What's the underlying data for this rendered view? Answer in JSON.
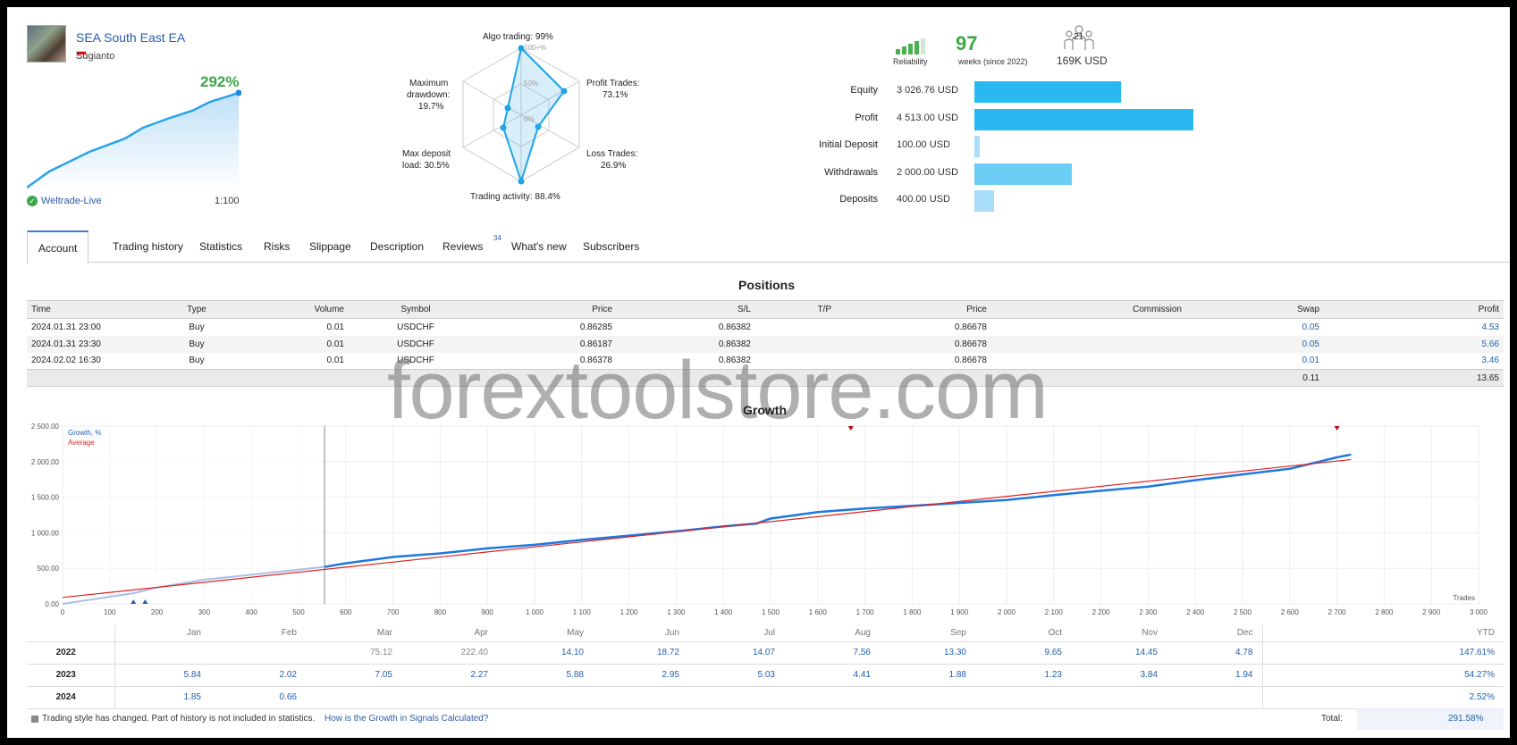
{
  "profile": {
    "name": "SEA South East EA",
    "author": "Sugianto",
    "growth": "292%",
    "broker": "Weltrade-Live",
    "leverage": "1:100"
  },
  "radar": {
    "algo": "Algo trading: 99%",
    "profit_trades": [
      "Profit Trades:",
      "73.1%"
    ],
    "loss_trades": [
      "Loss Trades:",
      "26.9%"
    ],
    "activity": "Trading activity: 88.4%",
    "deposit_load": [
      "Max deposit",
      "load: 30.5%"
    ],
    "drawdown": [
      "Maximum",
      "drawdown:",
      "19.7%"
    ],
    "ring_labels": [
      "100+%",
      "50%",
      "0%"
    ]
  },
  "stats": {
    "reliability_label": "Reliability",
    "weeks": "97",
    "weeks_label": "weeks (since 2022)",
    "subscribers": "21",
    "funds": "169K USD"
  },
  "balances": [
    {
      "label": "Equity",
      "value": "3 026.76 USD",
      "amount": 3026.76,
      "color": "#29b9f0"
    },
    {
      "label": "Profit",
      "value": "4 513.00 USD",
      "amount": 4513.0,
      "color": "#29b9f0"
    },
    {
      "label": "Initial Deposit",
      "value": "100.00 USD",
      "amount": 100.0,
      "color": "#a8def7"
    },
    {
      "label": "Withdrawals",
      "value": "2 000.00 USD",
      "amount": 2000.0,
      "color": "#6bcdf4"
    },
    {
      "label": "Deposits",
      "value": "400.00 USD",
      "amount": 400.0,
      "color": "#a8def7"
    }
  ],
  "tabs": [
    "Account",
    "Trading history",
    "Statistics",
    "Risks",
    "Slippage",
    "Description",
    "Reviews",
    "What's new",
    "Subscribers"
  ],
  "reviews_count": "34",
  "positions": {
    "title": "Positions",
    "headers": [
      "Time",
      "Type",
      "Volume",
      "Symbol",
      "Price",
      "S/L",
      "T/P",
      "Price",
      "Commission",
      "Swap",
      "Profit"
    ],
    "rows": [
      [
        "2024.01.31 23:00",
        "Buy",
        "0.01",
        "USDCHF",
        "0.86285",
        "0.86382",
        "",
        "0.86678",
        "",
        "0.05",
        "4.53"
      ],
      [
        "2024.01.31 23:30",
        "Buy",
        "0.01",
        "USDCHF",
        "0.86187",
        "0.86382",
        "",
        "0.86678",
        "",
        "0.05",
        "5.66"
      ],
      [
        "2024.02.02 16:30",
        "Buy",
        "0.01",
        "USDCHF",
        "0.86378",
        "0.86382",
        "",
        "0.86678",
        "",
        "0.01",
        "3.46"
      ]
    ],
    "total_swap": "0.11",
    "total_profit": "13.65"
  },
  "watermark": "forextoolstore.com",
  "growth_chart": {
    "title": "Growth",
    "legend_growth": "Growth, %",
    "legend_average": "Average",
    "x_label": "Trades",
    "y_ticks": [
      "0.00",
      "500.00",
      "1 000.00",
      "1 500.00",
      "2 000.00",
      "2 500.00"
    ],
    "x_ticks": [
      "0",
      "100",
      "200",
      "300",
      "400",
      "500",
      "600",
      "700",
      "800",
      "900",
      "1 000",
      "1 100",
      "1 200",
      "1 300",
      "1 400",
      "1 500",
      "1 600",
      "1 700",
      "1 800",
      "1 900",
      "2 000",
      "2 100",
      "2 200",
      "2 300",
      "2 400",
      "2 500",
      "2 600",
      "2 700",
      "2 800",
      "2 900",
      "3 000"
    ]
  },
  "chart_data": {
    "type": "line",
    "title": "Growth",
    "xlabel": "Trades",
    "ylabel": "",
    "xlim": [
      0,
      3000
    ],
    "ylim": [
      0,
      2500
    ],
    "grid": true,
    "legend": "top-left",
    "series": [
      {
        "name": "Growth, %",
        "color": "#1f78e0",
        "x": [
          0,
          50,
          100,
          150,
          200,
          300,
          400,
          555,
          600,
          700,
          800,
          900,
          1000,
          1100,
          1200,
          1300,
          1400,
          1470,
          1500,
          1600,
          1700,
          1800,
          1900,
          2000,
          2100,
          2200,
          2300,
          2400,
          2500,
          2600,
          2700,
          2730
        ],
        "y": [
          0,
          50,
          100,
          150,
          230,
          340,
          410,
          520,
          570,
          660,
          710,
          780,
          830,
          900,
          960,
          1020,
          1090,
          1130,
          1200,
          1290,
          1340,
          1380,
          1420,
          1460,
          1530,
          1590,
          1650,
          1740,
          1820,
          1900,
          2060,
          2100
        ]
      },
      {
        "name": "Average",
        "color": "#e02020",
        "x": [
          0,
          2730
        ],
        "y": [
          90,
          2030
        ]
      }
    ]
  },
  "monthly": {
    "months": [
      "Jan",
      "Feb",
      "Mar",
      "Apr",
      "May",
      "Jun",
      "Jul",
      "Aug",
      "Sep",
      "Oct",
      "Nov",
      "Dec"
    ],
    "ytd_label": "YTD",
    "rows": [
      {
        "year": "2022",
        "values": [
          "",
          "",
          "75.12",
          "222.40",
          "14.10",
          "18.72",
          "14.07",
          "7.56",
          "13.30",
          "9.65",
          "14.45",
          "4.78"
        ],
        "ytd": "147.61%"
      },
      {
        "year": "2023",
        "values": [
          "5.84",
          "2.02",
          "7.05",
          "2.27",
          "5.88",
          "2.95",
          "5.03",
          "4.41",
          "1.88",
          "1.23",
          "3.84",
          "1.94"
        ],
        "ytd": "54.27%"
      },
      {
        "year": "2024",
        "values": [
          "1.85",
          "0.66",
          "",
          "",
          "",
          "",
          "",
          "",
          "",
          "",
          "",
          ""
        ],
        "ytd": "2.52%"
      }
    ],
    "note": "Trading style has changed. Part of history is not included in statistics.",
    "note_link": "How is the Growth in Signals Calculated?",
    "total_label": "Total:",
    "total": "291.58%"
  }
}
